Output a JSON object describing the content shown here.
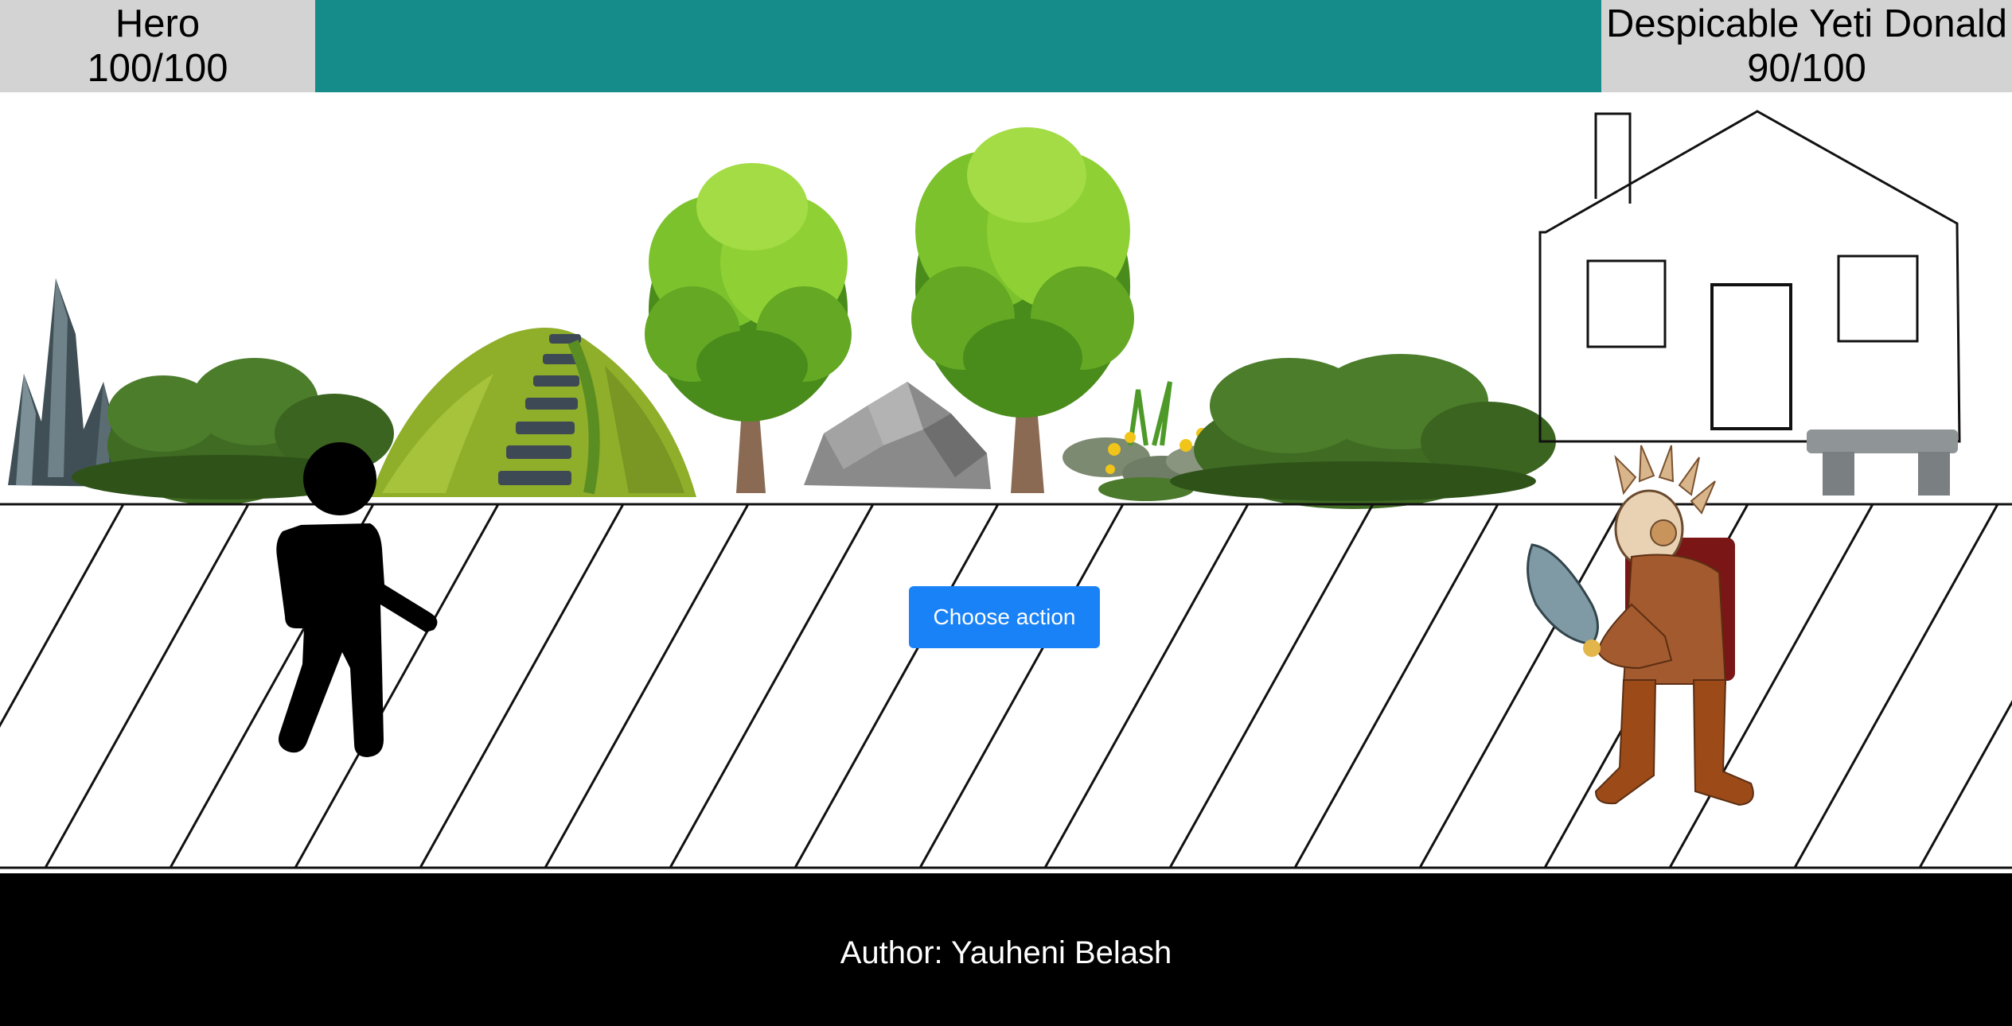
{
  "hud": {
    "hero": {
      "name": "Hero",
      "hp": "100/100"
    },
    "enemy": {
      "name": "Despicable Yeti Donald",
      "hp": "90/100"
    },
    "bar_color": "#158c8a"
  },
  "action_button": {
    "label": "Choose action",
    "color": "#1a82f7"
  },
  "footer": {
    "text": "Author: Yauheni Belash"
  },
  "scene": {
    "background_items": [
      "crystal-rock",
      "bush",
      "mossy-hill",
      "tree",
      "grey-boulder",
      "tree",
      "flower-stones",
      "bush",
      "house",
      "stone-bench"
    ],
    "characters": [
      "hero-stickman",
      "aztec-warrior-enemy"
    ]
  }
}
